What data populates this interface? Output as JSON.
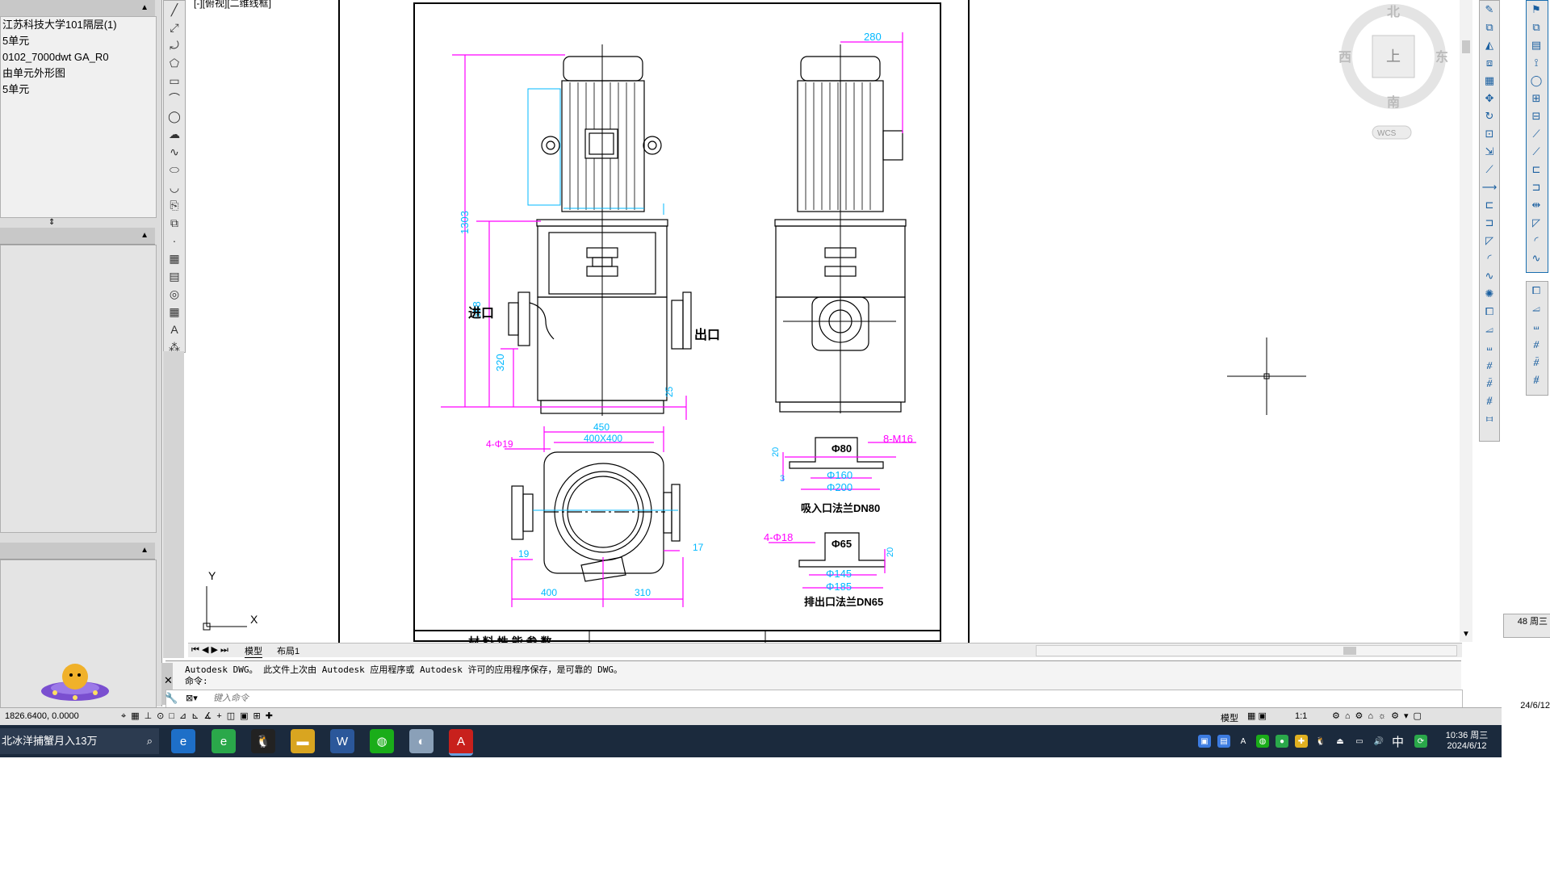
{
  "app": {
    "name": "AutoCAD"
  },
  "viewport_label": "[-][俯视][二维线框]",
  "left_panel": {
    "tree_items": [
      "江苏科技大学101隔层(1)",
      "5单元",
      "0102_7000dwt GA_R0",
      "由单元外形图",
      "5单元"
    ]
  },
  "drawing": {
    "front_view": {
      "dim_top": "280",
      "dim_height_total": "1303",
      "dim_height_mid": "688",
      "dim_height_low": "320",
      "dim_small": "25",
      "inlet_label": "进口",
      "outlet_label": "出口"
    },
    "plan_view": {
      "dim_450": "450",
      "dim_400x400": "400X400",
      "holes": "4-Φ19",
      "dim_19": "19",
      "dim_17": "17",
      "dim_400": "400",
      "dim_310": "310"
    },
    "suction_flange": {
      "bolts": "8-M16",
      "d_inner": "Φ80",
      "d_mid": "Φ160",
      "d_outer": "Φ200",
      "dim_20": "20",
      "dim_3": "3",
      "caption": "吸入口法兰DN80"
    },
    "discharge_flange": {
      "holes": "4-Φ18",
      "d_inner": "Φ65",
      "d_mid": "Φ145",
      "d_outer": "Φ185",
      "dim_20": "20",
      "caption": "排出口法兰DN65"
    },
    "title_block_text": "材  料       性 能 参 数"
  },
  "ucs": {
    "y": "Y",
    "x": "X"
  },
  "viewcube": {
    "north": "北",
    "south": "南",
    "west": "西",
    "east": "东",
    "top": "上",
    "wcs": "WCS"
  },
  "tabs": {
    "model": "模型",
    "layout1": "布局1"
  },
  "command": {
    "history": "Autodesk DWG。  此文件上次由 Autodesk 应用程序或 Autodesk 许可的应用程序保存，是可靠的 DWG。",
    "prompt": "命令:",
    "placeholder": "键入命令"
  },
  "status": {
    "coords": "1826.6400,  0.0000",
    "model_label": "模型",
    "scale": "1:1"
  },
  "taskbar": {
    "search_text": "北冰洋捕蟹月入13万",
    "time": "10:36 周三",
    "date": "2024/6/12",
    "ime": "中",
    "side_time": "48 周三",
    "side_date": "24/6/12"
  },
  "colors": {
    "accent": "#1a6fb0",
    "dim_magenta": "#ff00ff",
    "dim_cyan": "#00b8ff",
    "taskbar": "#1b2a3d"
  }
}
